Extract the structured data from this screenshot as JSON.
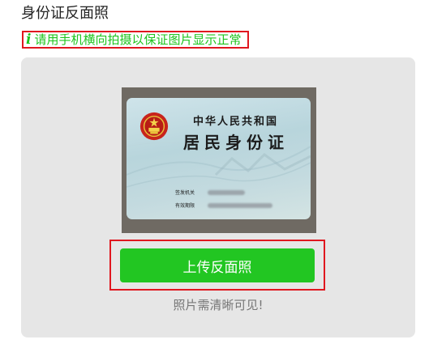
{
  "page": {
    "title": "身份证反面照"
  },
  "notice": {
    "icon": "info-icon",
    "icon_glyph": "i",
    "text": "请用手机横向拍摄以保证图片显示正常",
    "color": "#1ec41e",
    "highlight_color": "#e0171f"
  },
  "sample_card": {
    "nation": "中华人民共和国",
    "title": "居民身份证",
    "issuer_label": "签发机关",
    "validity_label": "有效期限"
  },
  "upload": {
    "button_label": "上传反面照",
    "button_color": "#22c622",
    "hint": "照片需清晰可见!"
  }
}
